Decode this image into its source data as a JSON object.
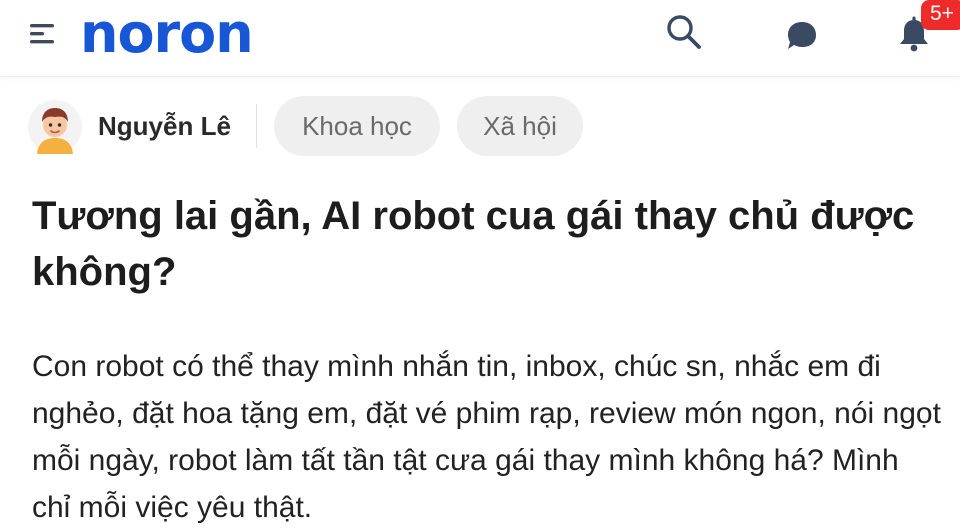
{
  "header": {
    "logo_text": "noron",
    "notification_badge": "5+",
    "icons": [
      "menu-icon",
      "search-icon",
      "chat-icon",
      "bell-icon"
    ]
  },
  "author": {
    "name": "Nguyễn Lê"
  },
  "tags": [
    {
      "label": "Khoa học"
    },
    {
      "label": "Xã hội"
    }
  ],
  "post": {
    "title": "Tương lai gần, AI robot cua gái thay chủ được không?",
    "body": "Con robot có thể thay mình nhắn tin, inbox, chúc sn, nhắc em đi nghẻo, đặt hoa tặng em, đặt vé phim rạp, review món ngon, nói ngọt mỗi ngày, robot làm tất tần tật cưa gái thay mình không há? Mình chỉ mỗi việc yêu thật."
  },
  "colors": {
    "brand": "#1757d6",
    "badge": "#ee2a2a",
    "chip_bg": "#efefef"
  }
}
